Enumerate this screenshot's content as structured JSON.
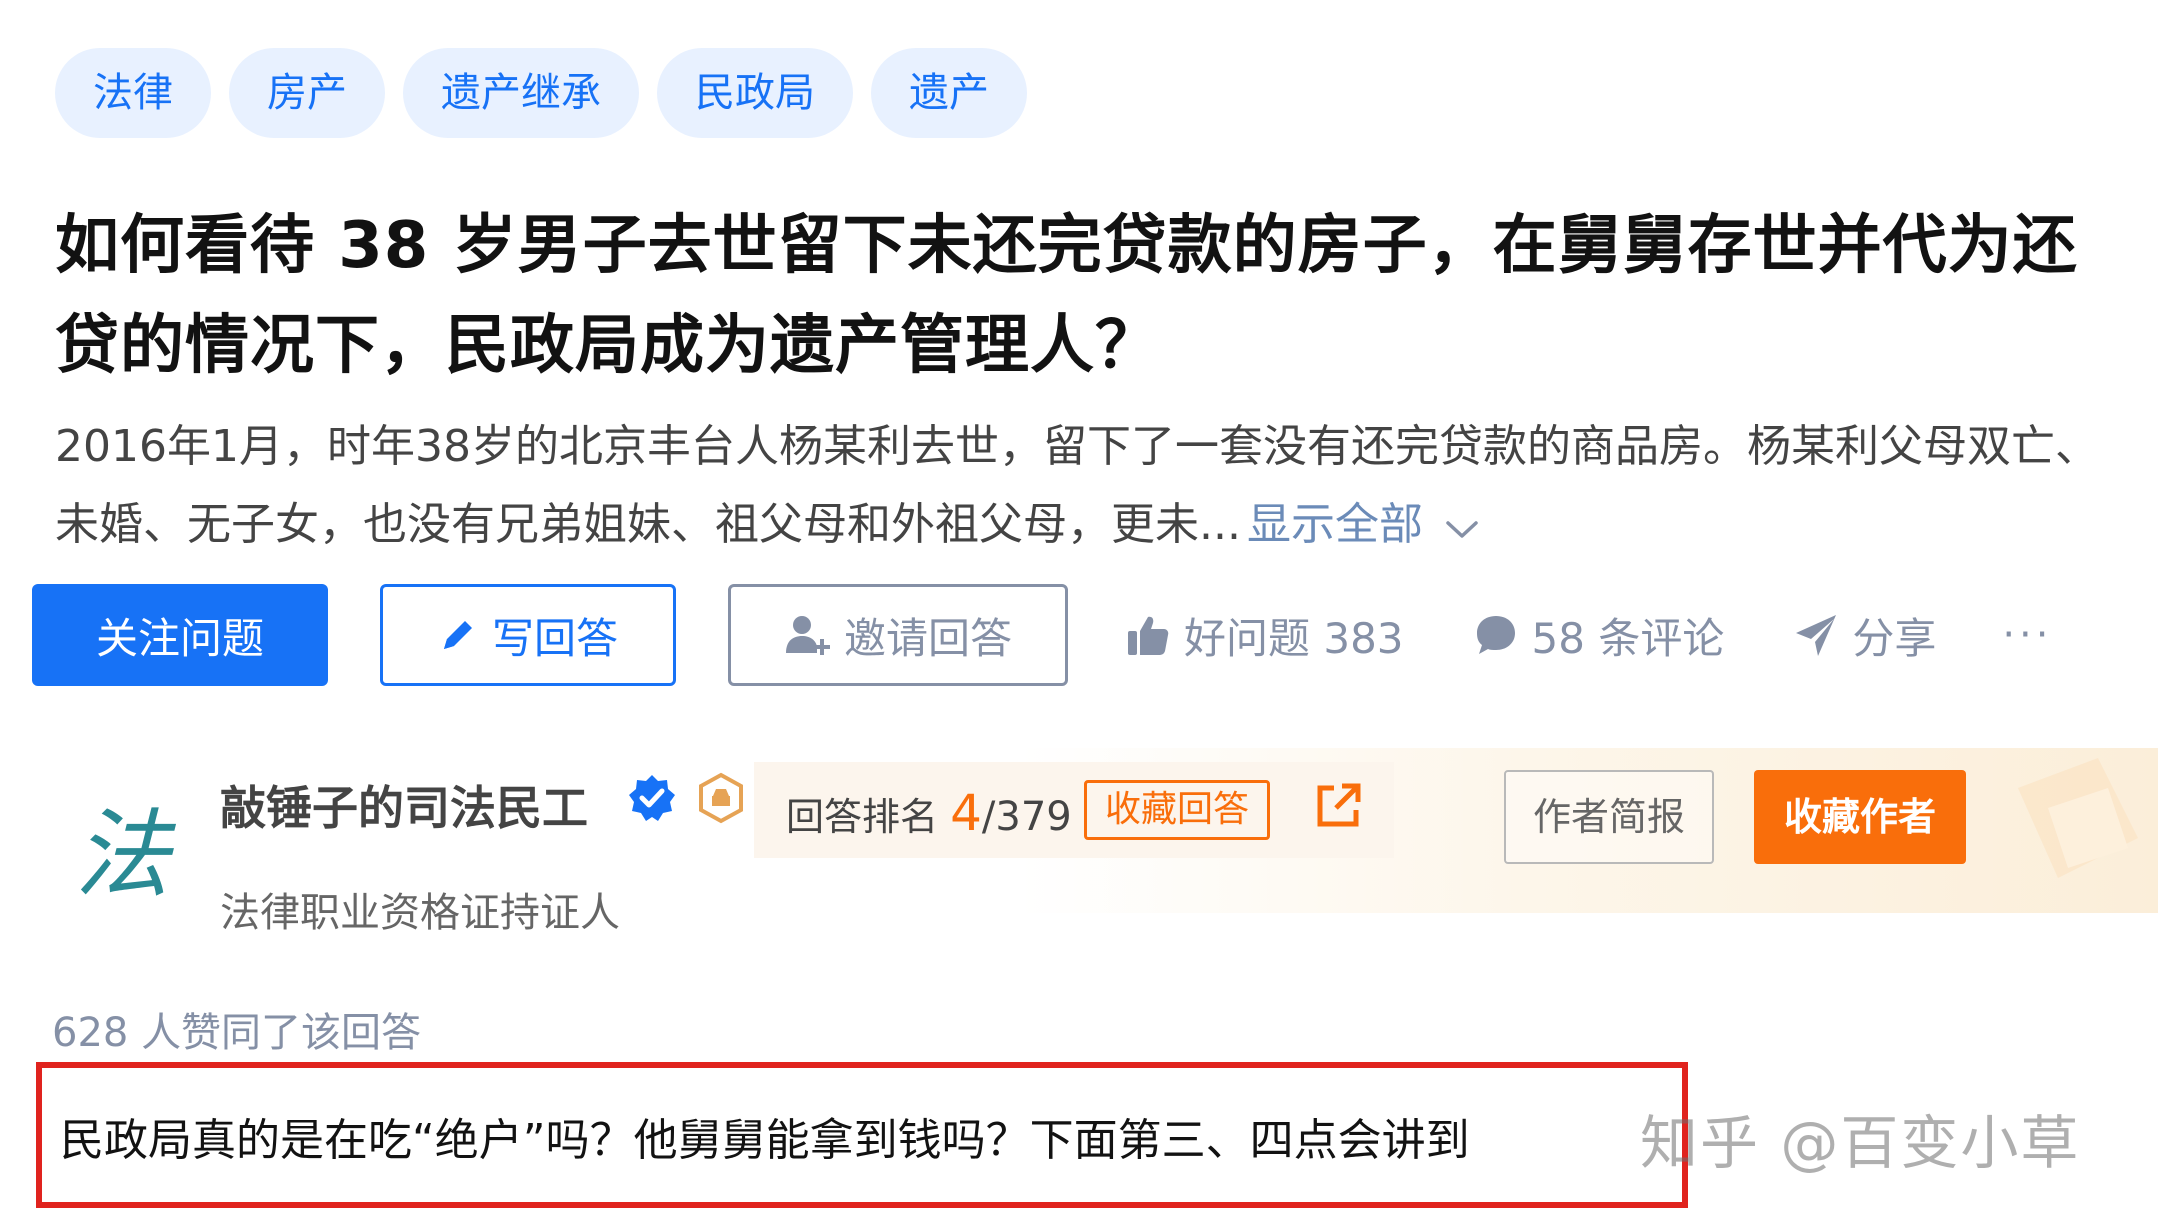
{
  "tags": [
    "法律",
    "房产",
    "遗产继承",
    "民政局",
    "遗产"
  ],
  "question": {
    "title": "如何看待 38 岁男子去世留下未还完贷款的房子，在舅舅存世并代为还贷的情况下，民政局成为遗产管理人？",
    "excerpt": "2016年1月，时年38岁的北京丰台人杨某利去世，留下了一套没有还完贷款的商品房。杨某利父母双亡、未婚、无子女，也没有兄弟姐妹、祖父母和外祖父母，更未...",
    "show_all": "显示全部"
  },
  "actions": {
    "follow": "关注问题",
    "write": "写回答",
    "invite": "邀请回答",
    "like": "好问题 383",
    "comments": "58 条评论",
    "share": "分享",
    "more": "···"
  },
  "author": {
    "name": "敲锤子的司法民工",
    "bio": "法律职业资格证持证人",
    "rank_label": "回答排名",
    "rank_value": "4",
    "rank_total": "/379",
    "collect_answer": "收藏回答",
    "brief": "作者简报",
    "collect_author": "收藏作者",
    "avatar_text": "法"
  },
  "answer": {
    "voters": "628 人赞同了该回答",
    "text": "民政局真的是在吃“绝户”吗？他舅舅能拿到钱吗？下面第三、四点会讲到"
  },
  "watermark": "知乎 @百变小草",
  "colors": {
    "brand_blue": "#1772f6",
    "accent_orange": "#f96e0b",
    "highlight_red": "#e0231e"
  }
}
